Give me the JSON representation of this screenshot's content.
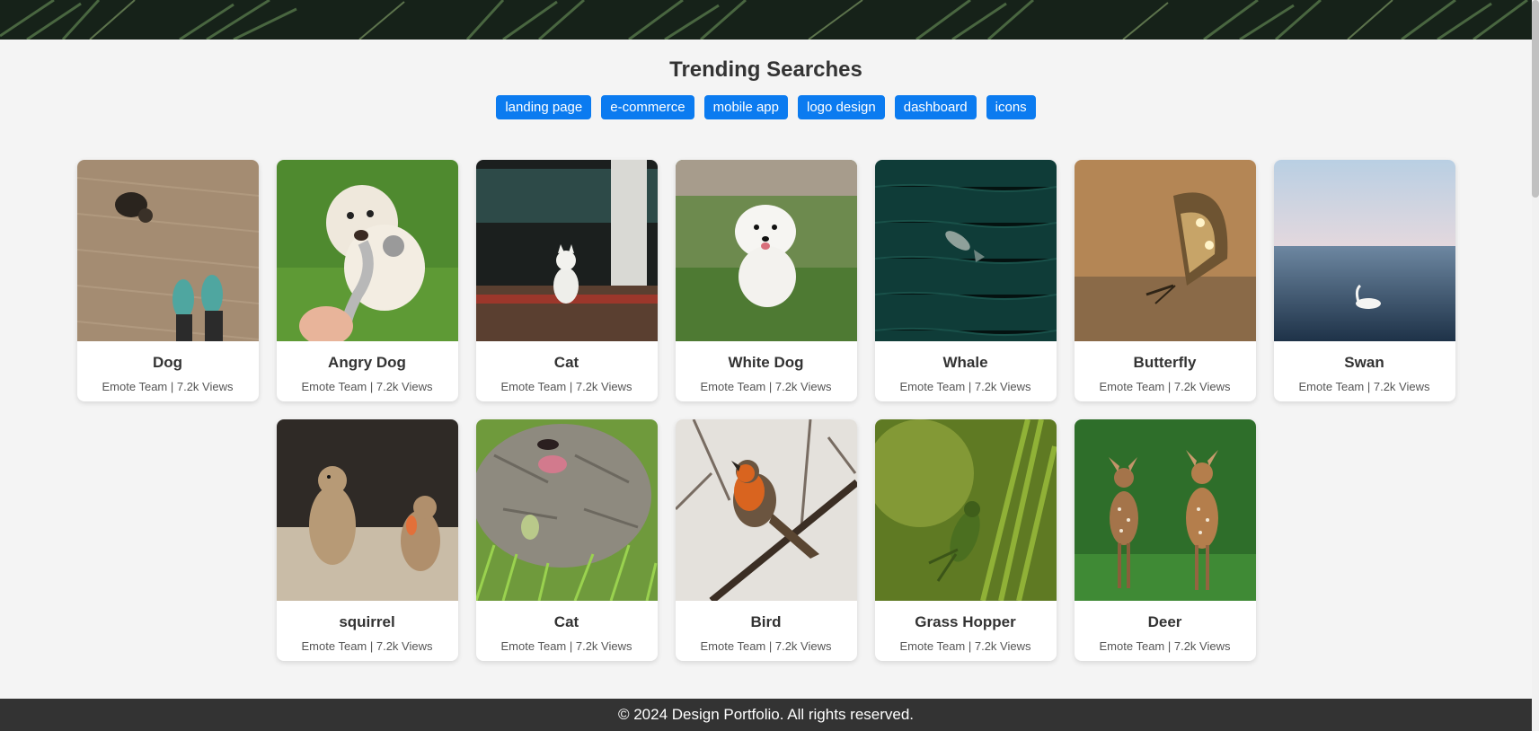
{
  "header": {
    "title": "Trending Searches"
  },
  "tags": [
    {
      "label": "landing page"
    },
    {
      "label": "e-commerce"
    },
    {
      "label": "mobile app"
    },
    {
      "label": "logo design"
    },
    {
      "label": "dashboard"
    },
    {
      "label": "icons"
    }
  ],
  "cards": [
    {
      "title": "Dog",
      "meta": "Emote Team | 7.2k Views",
      "photo": "dog-on-carpet-photo"
    },
    {
      "title": "Angry Dog",
      "meta": "Emote Team | 7.2k Views",
      "photo": "dog-tug-rope-photo"
    },
    {
      "title": "Cat",
      "meta": "Emote Team | 7.2k Views",
      "photo": "white-cat-room-photo"
    },
    {
      "title": "White Dog",
      "meta": "Emote Team | 7.2k Views",
      "photo": "white-dog-grass-photo"
    },
    {
      "title": "Whale",
      "meta": "Emote Team | 7.2k Views",
      "photo": "whale-ocean-photo"
    },
    {
      "title": "Butterfly",
      "meta": "Emote Team | 7.2k Views",
      "photo": "butterfly-photo"
    },
    {
      "title": "Swan",
      "meta": "Emote Team | 7.2k Views",
      "photo": "swan-lake-photo"
    },
    {
      "title": "squirrel",
      "meta": "Emote Team | 7.2k Views",
      "photo": "squirrels-photo"
    },
    {
      "title": "Cat",
      "meta": "Emote Team | 7.2k Views",
      "photo": "cat-in-grass-photo"
    },
    {
      "title": "Bird",
      "meta": "Emote Team | 7.2k Views",
      "photo": "robin-bird-photo"
    },
    {
      "title": "Grass Hopper",
      "meta": "Emote Team | 7.2k Views",
      "photo": "grasshopper-photo"
    },
    {
      "title": "Deer",
      "meta": "Emote Team | 7.2k Views",
      "photo": "deer-fawns-photo"
    }
  ],
  "footer": {
    "text": "© 2024 Design Portfolio. All rights reserved."
  },
  "colors": {
    "tag_bg": "#0b7bf0",
    "footer_bg": "#333333",
    "page_bg": "#f4f4f4"
  }
}
